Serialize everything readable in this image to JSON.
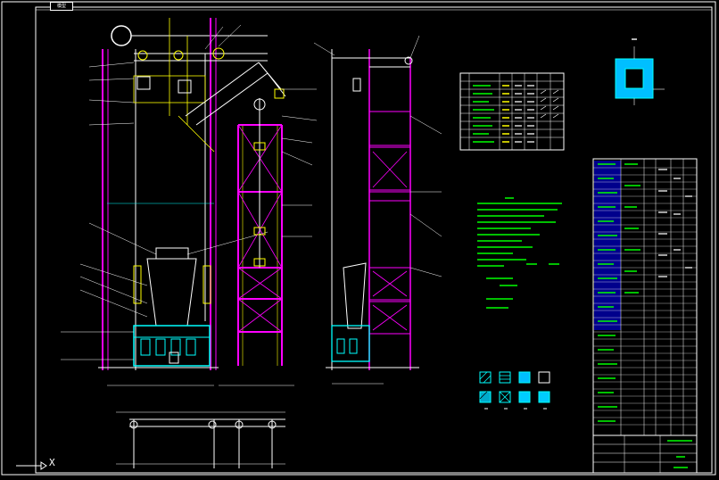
{
  "viewport": {
    "tab_label": "模型",
    "ucs_axis_label": "X"
  },
  "colors": {
    "background": "#000000",
    "frame": "#ffffff",
    "structure": "#00ffff",
    "members": "#ffffff",
    "hidden": "#ff00ff",
    "annotation": "#00ff00",
    "accent": "#ffff00",
    "fill": "#0000ff"
  },
  "drawing": {
    "views": [
      "elevation-front",
      "elevation-side",
      "section-a-a",
      "plan-bottom"
    ],
    "legend_swatch_count": 8,
    "note_lines": 12,
    "title_block": {
      "rows": 40,
      "columns": 6
    },
    "material_table": {
      "rows": 9,
      "columns": 8
    }
  }
}
